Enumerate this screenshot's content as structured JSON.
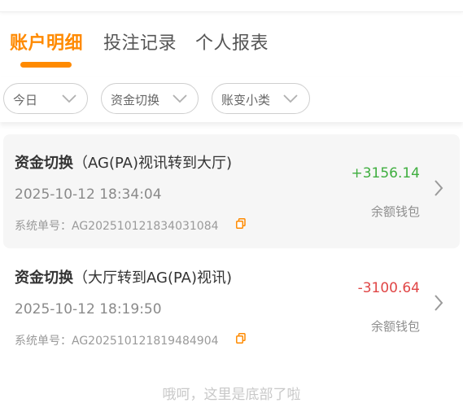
{
  "tabs": {
    "items": [
      {
        "label": "账户明细"
      },
      {
        "label": "投注记录"
      },
      {
        "label": "个人报表"
      }
    ]
  },
  "filters": {
    "date": {
      "label": "今日"
    },
    "type": {
      "label": "资金切换"
    },
    "subtype": {
      "label": "账变小类"
    }
  },
  "records": [
    {
      "title": "资金切换",
      "detail": "（AG(PA)视讯转到大厅)",
      "date": "2025-10-12 18:34:04",
      "order_label": "系统单号：",
      "order_no": "AG202510121834031084",
      "amount": "+3156.14",
      "wallet": "余额钱包"
    },
    {
      "title": "资金切换",
      "detail": "（大厅转到AG(PA)视讯)",
      "date": "2025-10-12 18:19:50",
      "order_label": "系统单号：",
      "order_no": "AG202510121819484904",
      "amount": "-3100.64",
      "wallet": "余额钱包"
    }
  ],
  "footer": {
    "text": "哦呵，这里是底部了啦"
  },
  "colors": {
    "accent": "#ff8a00",
    "positive": "#3fae3f",
    "negative": "#e04646"
  }
}
